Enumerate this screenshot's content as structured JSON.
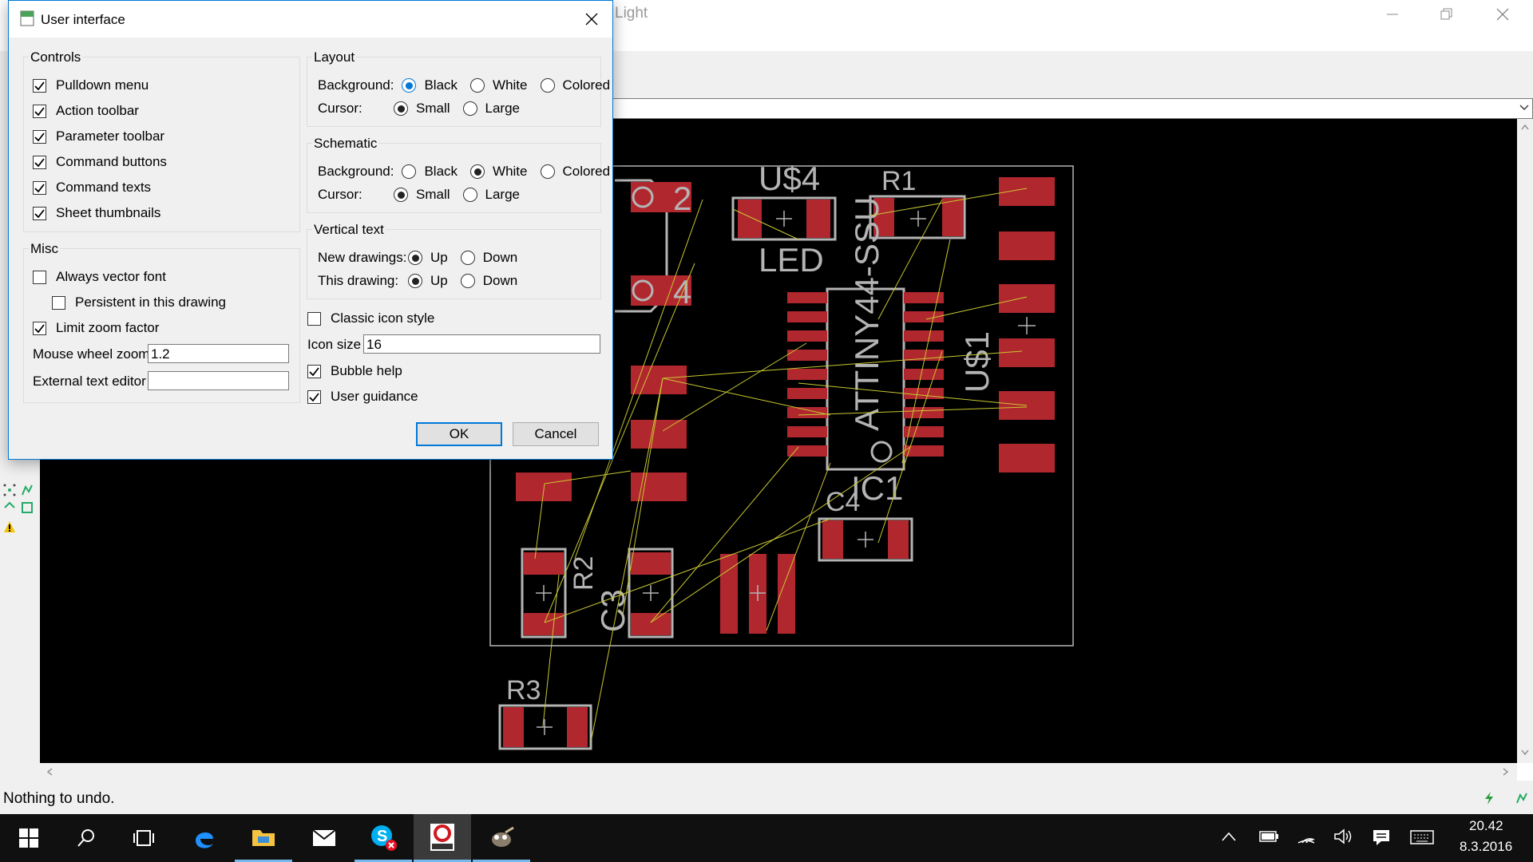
{
  "main_window": {
    "title_fragment": "Light",
    "minimize_icon": "minimize-icon",
    "restore_icon": "restore-icon",
    "close_icon": "close-icon",
    "status_text": "Nothing to undo."
  },
  "board": {
    "labels": [
      "U$4",
      "LED",
      "R1",
      "ATTINY44-SSU",
      "U$1",
      "IC1",
      "C4",
      "R2",
      "C3",
      "R3",
      "2",
      "4"
    ],
    "colors": {
      "background": "#000000",
      "pad": "#b1272e",
      "outline": "#b4b4b4",
      "airwire": "#c8c832"
    }
  },
  "dialog": {
    "title": "User interface",
    "controls": {
      "legend": "Controls",
      "items": [
        {
          "label": "Pulldown menu",
          "checked": true
        },
        {
          "label": "Action toolbar",
          "checked": true
        },
        {
          "label": "Parameter toolbar",
          "checked": true
        },
        {
          "label": "Command buttons",
          "checked": true
        },
        {
          "label": "Command texts",
          "checked": true
        },
        {
          "label": "Sheet thumbnails",
          "checked": true
        }
      ]
    },
    "misc": {
      "legend": "Misc",
      "always_vector_font": "Always vector font",
      "persistent": "Persistent in this drawing",
      "limit_zoom": "Limit zoom factor",
      "mouse_wheel_label": "Mouse wheel zoom",
      "mouse_wheel_value": "1.2",
      "external_editor_label": "External text editor",
      "external_editor_value": ""
    },
    "layout": {
      "legend": "Layout",
      "background_label": "Background:",
      "cursor_label": "Cursor:",
      "options_bg": [
        "Black",
        "White",
        "Colored"
      ],
      "selected_bg": "Black",
      "options_cursor": [
        "Small",
        "Large"
      ],
      "selected_cursor": "Small"
    },
    "schematic": {
      "legend": "Schematic",
      "background_label": "Background:",
      "cursor_label": "Cursor:",
      "options_bg": [
        "Black",
        "White",
        "Colored"
      ],
      "selected_bg": "White",
      "options_cursor": [
        "Small",
        "Large"
      ],
      "selected_cursor": "Small"
    },
    "vertical_text": {
      "legend": "Vertical text",
      "new_label": "New drawings:",
      "this_label": "This drawing:",
      "options": [
        "Up",
        "Down"
      ],
      "selected_new": "Up",
      "selected_this": "Up"
    },
    "classic_icon_style": "Classic icon style",
    "icon_size_label": "Icon size",
    "icon_size_value": "16",
    "bubble_help": "Bubble help",
    "user_guidance": "User guidance",
    "ok": "OK",
    "cancel": "Cancel"
  },
  "taskbar": {
    "time": "20.42",
    "date": "8.3.2016",
    "apps": [
      "start-icon",
      "search-icon",
      "task-view-icon",
      "edge-icon",
      "file-explorer-icon",
      "mail-icon",
      "skype-icon",
      "eagle-icon",
      "gimp-icon"
    ]
  }
}
